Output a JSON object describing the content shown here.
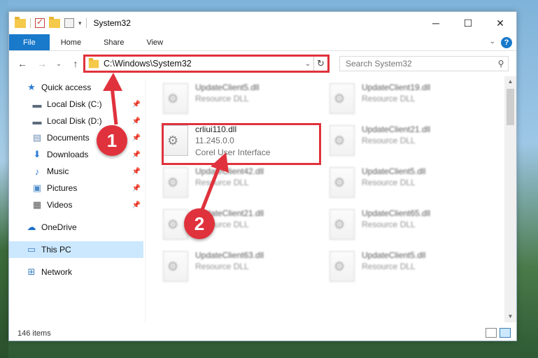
{
  "window": {
    "title": "System32",
    "controls": {
      "minimize": "─",
      "maximize": "☐",
      "close": "✕"
    }
  },
  "ribbon": {
    "tabs": [
      {
        "label": "File"
      },
      {
        "label": "Home"
      },
      {
        "label": "Share"
      },
      {
        "label": "View"
      }
    ],
    "help": "?"
  },
  "nav": {
    "back": "←",
    "forward": "→",
    "recent": "⌄",
    "up": "↑",
    "address": "C:\\Windows\\System32",
    "refresh": "↻",
    "search_placeholder": "Search System32"
  },
  "sidebar": {
    "items": [
      {
        "label": "Quick access",
        "icon": "star-icon",
        "pinned": false
      },
      {
        "label": "Local Disk (C:)",
        "icon": "drive-icon",
        "pinned": true
      },
      {
        "label": "Local Disk (D:)",
        "icon": "drive-icon",
        "pinned": true
      },
      {
        "label": "Documents",
        "icon": "documents-icon",
        "pinned": true
      },
      {
        "label": "Downloads",
        "icon": "download-icon",
        "pinned": true
      },
      {
        "label": "Music",
        "icon": "music-icon",
        "pinned": true
      },
      {
        "label": "Pictures",
        "icon": "pictures-icon",
        "pinned": true
      },
      {
        "label": "Videos",
        "icon": "videos-icon",
        "pinned": true
      },
      {
        "label": "OneDrive",
        "icon": "cloud-icon",
        "pinned": false
      },
      {
        "label": "This PC",
        "icon": "computer-icon",
        "pinned": false,
        "selected": true
      },
      {
        "label": "Network",
        "icon": "network-icon",
        "pinned": false
      }
    ]
  },
  "files": {
    "left": [
      {
        "name": "UpdateClient5.dll",
        "line2": "Resource DLL",
        "blurred": true
      },
      {
        "name": "crliui110.dll",
        "line2": "11.245.0.0",
        "line3": "Corel User Interface",
        "blurred": false
      },
      {
        "name": "UpdateClient42.dll",
        "line2": "Resource DLL",
        "blurred": true
      },
      {
        "name": "UpdateClient21.dll",
        "line2": "Resource DLL",
        "blurred": true
      },
      {
        "name": "UpdateClient63.dll",
        "line2": "Resource DLL",
        "blurred": true
      }
    ],
    "right": [
      {
        "name": "UpdateClient19.dll",
        "line2": "Resource DLL"
      },
      {
        "name": "UpdateClient21.dll",
        "line2": "Resource DLL"
      },
      {
        "name": "UpdateClient5.dll",
        "line2": "Resource DLL"
      },
      {
        "name": "UpdateClient65.dll",
        "line2": "Resource DLL"
      },
      {
        "name": "UpdateClient5.dll",
        "line2": "Resource DLL"
      }
    ]
  },
  "status": {
    "item_count": "146 items"
  },
  "annotations": {
    "step1": "1",
    "step2": "2",
    "color": "#e0323c"
  }
}
